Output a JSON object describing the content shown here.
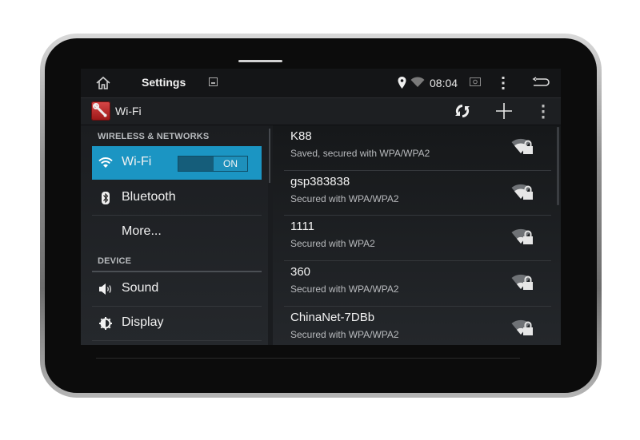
{
  "statusbar": {
    "title": "Settings",
    "time": "08:04",
    "icons": [
      "home-icon",
      "image-icon",
      "location-icon",
      "wifi-icon",
      "screenshot-icon",
      "menu-icon",
      "back-icon"
    ]
  },
  "actionbar": {
    "title": "Wi-Fi",
    "icons": [
      "settings-wrench-icon",
      "wps-refresh-icon",
      "add-network-icon",
      "overflow-menu-icon"
    ]
  },
  "sidebar": {
    "sections": [
      {
        "header": "WIRELESS & NETWORKS",
        "items": [
          {
            "label": "Wi-Fi",
            "icon": "wifi-icon",
            "active": true,
            "toggle": "ON"
          },
          {
            "label": "Bluetooth",
            "icon": "bluetooth-icon"
          },
          {
            "label": "More..."
          }
        ]
      },
      {
        "header": "DEVICE",
        "items": [
          {
            "label": "Sound",
            "icon": "speaker-icon"
          },
          {
            "label": "Display",
            "icon": "brightness-icon"
          }
        ]
      }
    ]
  },
  "networks": [
    {
      "ssid": "K88",
      "security": "Saved, secured with WPA/WPA2"
    },
    {
      "ssid": "gsp383838",
      "security": "Secured with WPA/WPA2"
    },
    {
      "ssid": "1111",
      "security": "Secured with WPA2"
    },
    {
      "ssid": "360",
      "security": "Secured with WPA/WPA2"
    },
    {
      "ssid": "ChinaNet-7DBb",
      "security": "Secured with WPA/WPA2"
    }
  ],
  "colors": {
    "accent": "#1b95c3",
    "background": "#1a1c1f",
    "app_icon": "#c62828"
  }
}
